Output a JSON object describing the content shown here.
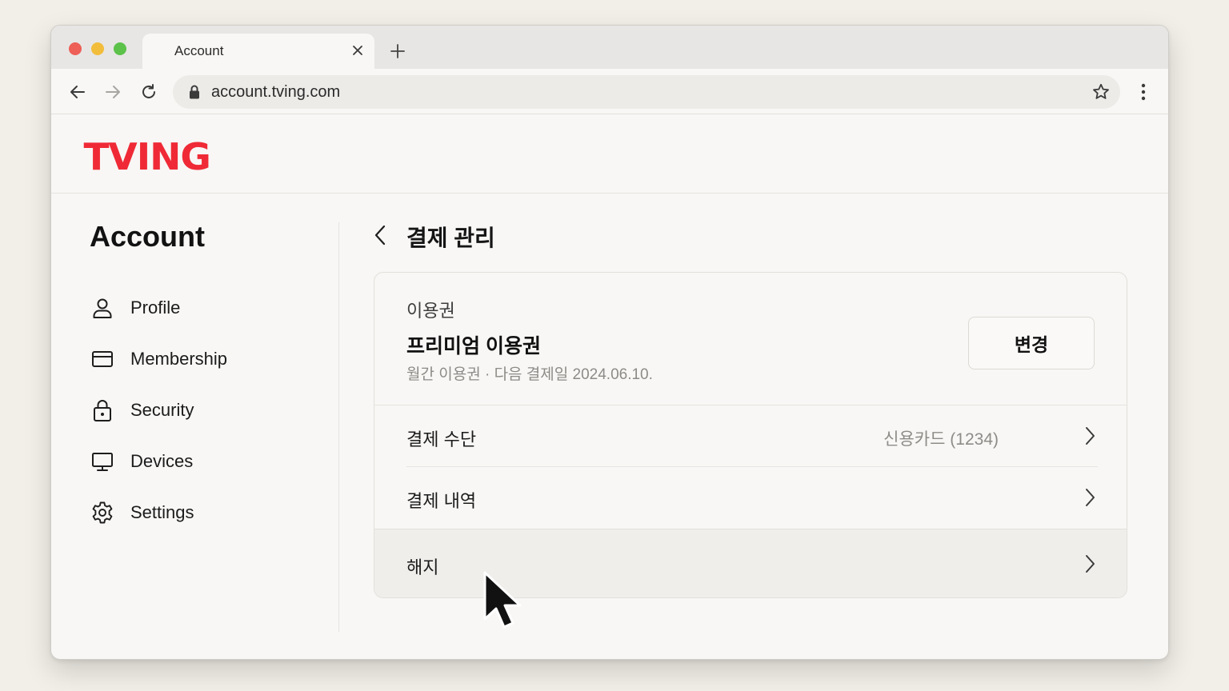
{
  "browser": {
    "tab_title": "Account",
    "url": "account.tving.com"
  },
  "site": {
    "logo_text": "TVING",
    "brand_color": "#ef2a36"
  },
  "sidebar": {
    "title": "Account",
    "items": [
      {
        "label": "Profile",
        "icon": "person-icon"
      },
      {
        "label": "Membership",
        "icon": "card-icon"
      },
      {
        "label": "Security",
        "icon": "lock-icon"
      },
      {
        "label": "Devices",
        "icon": "monitor-icon"
      },
      {
        "label": "Settings",
        "icon": "gear-icon"
      }
    ]
  },
  "main": {
    "page_title": "결제 관리",
    "plan": {
      "label": "이용권",
      "name": "프리미엄 이용권",
      "meta": "월간 이용권 · 다음 결제일 2024.06.10.",
      "change_label": "변경"
    },
    "rows": [
      {
        "label": "결제 수단",
        "value": "신용카드 (1234)"
      },
      {
        "label": "결제 내역",
        "value": ""
      },
      {
        "label": "해지",
        "value": ""
      }
    ]
  }
}
